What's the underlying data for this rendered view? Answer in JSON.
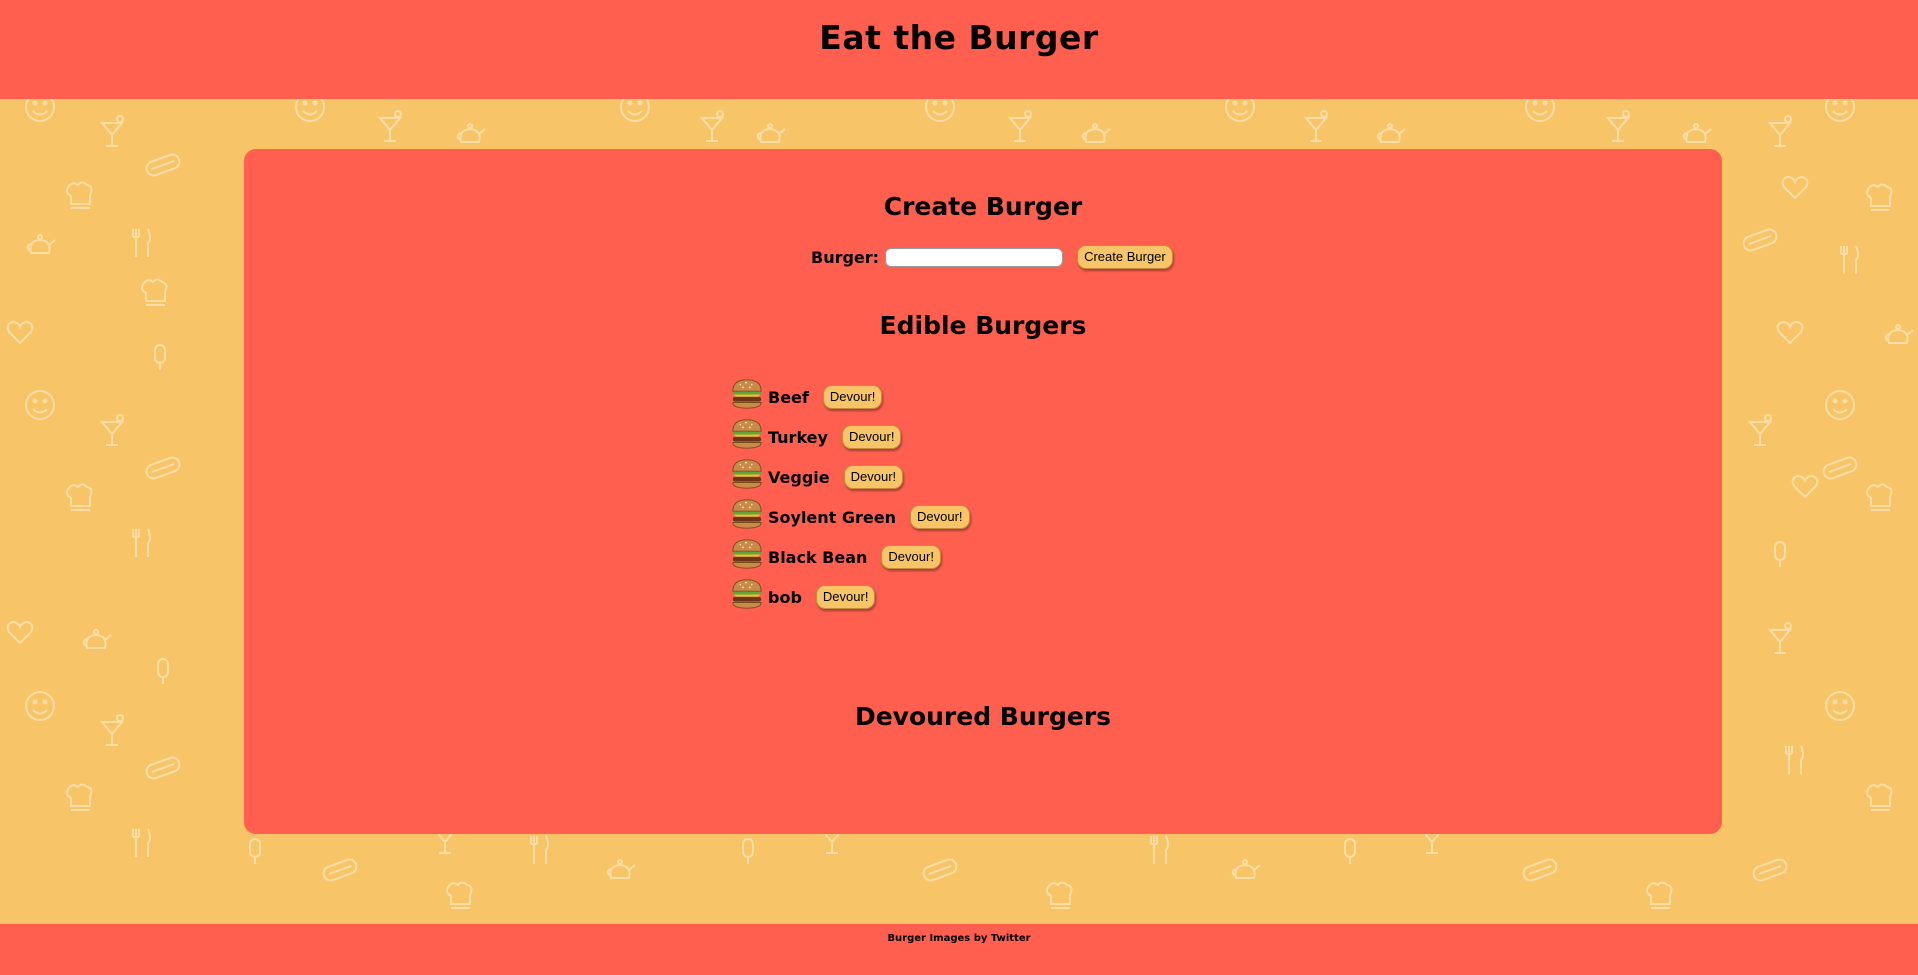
{
  "header": {
    "title": "Eat the Burger"
  },
  "create": {
    "title": "Create Burger",
    "label": "Burger:",
    "input_value": "",
    "button_label": "Create Burger"
  },
  "edible": {
    "title": "Edible Burgers",
    "items": [
      {
        "name": "Beef",
        "button_label": "Devour!"
      },
      {
        "name": "Turkey",
        "button_label": "Devour!"
      },
      {
        "name": "Veggie",
        "button_label": "Devour!"
      },
      {
        "name": "Soylent Green",
        "button_label": "Devour!"
      },
      {
        "name": "Black Bean",
        "button_label": "Devour!"
      },
      {
        "name": "bob",
        "button_label": "Devour!"
      }
    ]
  },
  "devoured": {
    "title": "Devoured Burgers",
    "items": []
  },
  "footer": {
    "credit": "Burger Images by Twitter"
  },
  "colors": {
    "background": "#f8c468",
    "panel": "#ff5f4e",
    "button": "#f8c468"
  },
  "icons": {
    "burger": "burger-icon",
    "pattern": [
      "smiley-icon",
      "cocktail-icon",
      "hotdog-icon",
      "chef-hat-icon",
      "fork-knife-icon",
      "teapot-icon",
      "heart-icon",
      "ice-pop-icon"
    ]
  }
}
